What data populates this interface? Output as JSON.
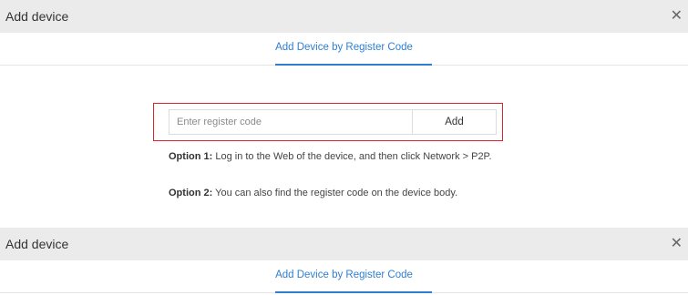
{
  "dialog_top": {
    "title": "Add device",
    "close_glyph": "✕",
    "tab_label": "Add Device by Register Code",
    "input_placeholder": "Enter register code",
    "input_value": "",
    "add_button": "Add",
    "option1_label": "Option 1:",
    "option1_text": " Log in to the Web of the device, and then click Network > P2P.",
    "option2_label": "Option 2:",
    "option2_text": " You can also find the register code on the device body."
  },
  "dialog_bottom": {
    "title": "Add device",
    "close_glyph": "✕",
    "tab_label": "Add Device by Register Code"
  },
  "colors": {
    "accent": "#2f7fd1",
    "highlight_border": "#d9262c",
    "titlebar_bg": "#ebebeb"
  },
  "icons": {
    "close": "close-icon"
  }
}
